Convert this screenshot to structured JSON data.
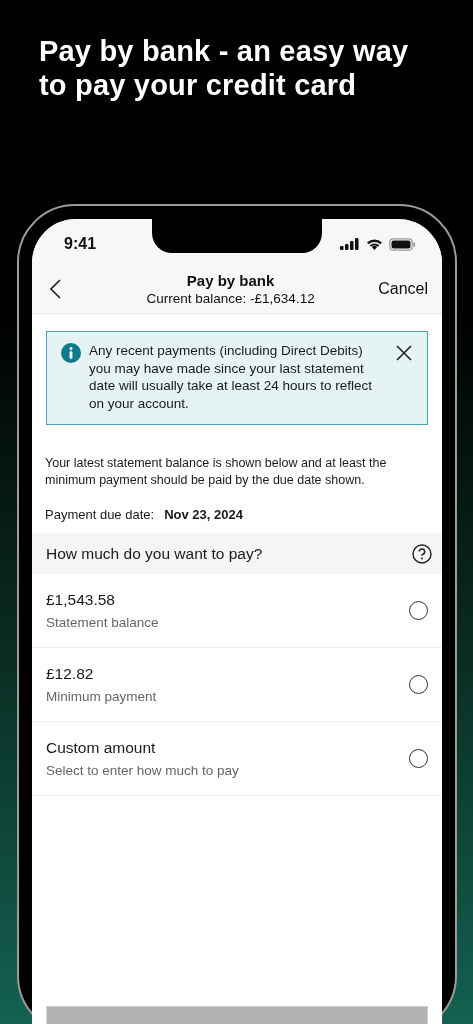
{
  "headline": "Pay by bank - an easy way to pay your credit card",
  "status_bar": {
    "time": "9:41"
  },
  "header": {
    "title": "Pay by bank",
    "subtitle": "Current balance: -£1,634.12",
    "action": "Cancel"
  },
  "info_banner": {
    "text": "Any recent payments (including Direct Debits) you may have made since your last statement date will usually take at least 24 hours to reflect on your account."
  },
  "intro": "Your latest statement balance is shown below and at least the minimum payment should be paid by the due date shown.",
  "due_date": {
    "label": "Payment due date:",
    "value": "Nov 23, 2024"
  },
  "question": "How much do you want to pay?",
  "options": [
    {
      "title": "£1,543.58",
      "subtitle": "Statement balance",
      "selected": false
    },
    {
      "title": "£12.82",
      "subtitle": "Minimum payment",
      "selected": false
    },
    {
      "title": "Custom amount",
      "subtitle": "Select to enter how much to pay",
      "selected": false
    }
  ]
}
